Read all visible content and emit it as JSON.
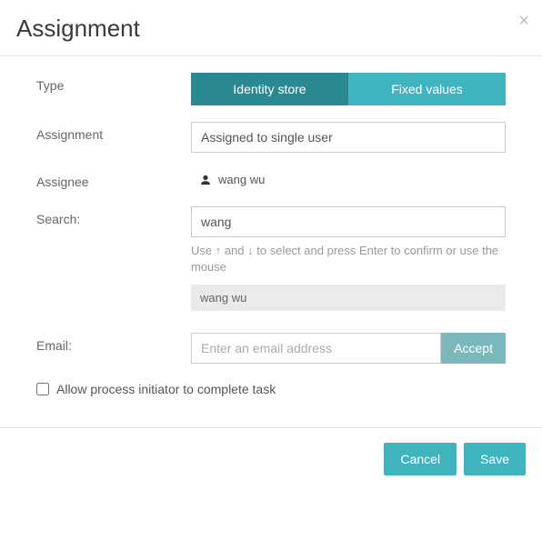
{
  "header": {
    "title": "Assignment"
  },
  "labels": {
    "type": "Type",
    "assignment": "Assignment",
    "assignee": "Assignee",
    "search": "Search:",
    "email": "Email:"
  },
  "tabs": {
    "identity_store": "Identity store",
    "fixed_values": "Fixed values"
  },
  "assignment_select": "Assigned to single user",
  "assignee_value": "wang wu",
  "search": {
    "value": "wang",
    "hint": "Use ↑ and ↓ to select and press Enter to confirm or use the mouse",
    "result": "wang wu"
  },
  "email": {
    "placeholder": "Enter an email address",
    "accept_label": "Accept"
  },
  "checkbox": {
    "label": "Allow process initiator to complete task",
    "checked": false
  },
  "footer": {
    "cancel": "Cancel",
    "save": "Save"
  }
}
